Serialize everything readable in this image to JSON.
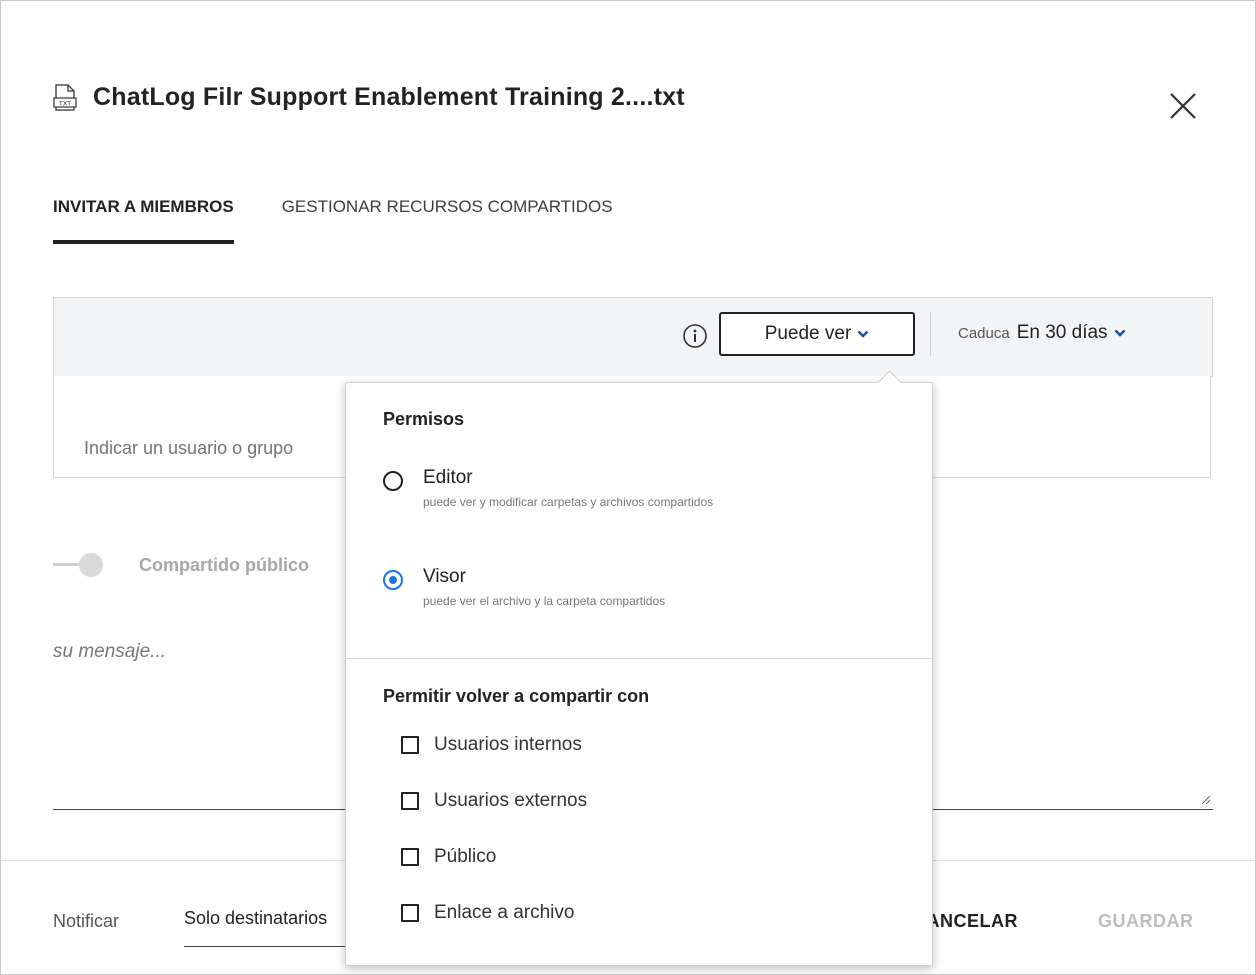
{
  "dialog": {
    "title": "ChatLog Filr Support Enablement Training 2....txt",
    "file_type_icon": "txt-file-icon",
    "file_type_label": "TXT"
  },
  "tabs": [
    {
      "label": "INVITAR A MIEMBROS",
      "active": true
    },
    {
      "label": "GESTIONAR RECURSOS COMPARTIDOS",
      "active": false
    }
  ],
  "toolbar": {
    "permission_label": "Puede ver",
    "expire_label": "Caduca",
    "expire_value": "En 30 días"
  },
  "user_input": {
    "placeholder": "Indicar un usuario o grupo"
  },
  "public_share": {
    "label": "Compartido público",
    "enabled": false
  },
  "message": {
    "placeholder": "su mensaje..."
  },
  "footer": {
    "notify_label": "Notificar",
    "notify_value": "Solo destinatarios",
    "cancel_label": "CANCELAR",
    "save_label": "GUARDAR"
  },
  "permissions_menu": {
    "heading": "Permisos",
    "options": [
      {
        "label": "Editor",
        "description": "puede ver y modificar carpetas y archivos compartidos",
        "selected": false
      },
      {
        "label": "Visor",
        "description": "puede ver el archivo y la carpeta compartidos",
        "selected": true
      }
    ],
    "reshare_heading": "Permitir volver a compartir con",
    "reshare_options": [
      {
        "label": "Usuarios internos",
        "checked": false
      },
      {
        "label": "Usuarios externos",
        "checked": false
      },
      {
        "label": "Público",
        "checked": false
      },
      {
        "label": "Enlace a archivo",
        "checked": false
      }
    ]
  },
  "colors": {
    "accent": "#1a73e8",
    "toolbar_bg": "#f3f4f6",
    "disabled": "#bdbdbd"
  }
}
